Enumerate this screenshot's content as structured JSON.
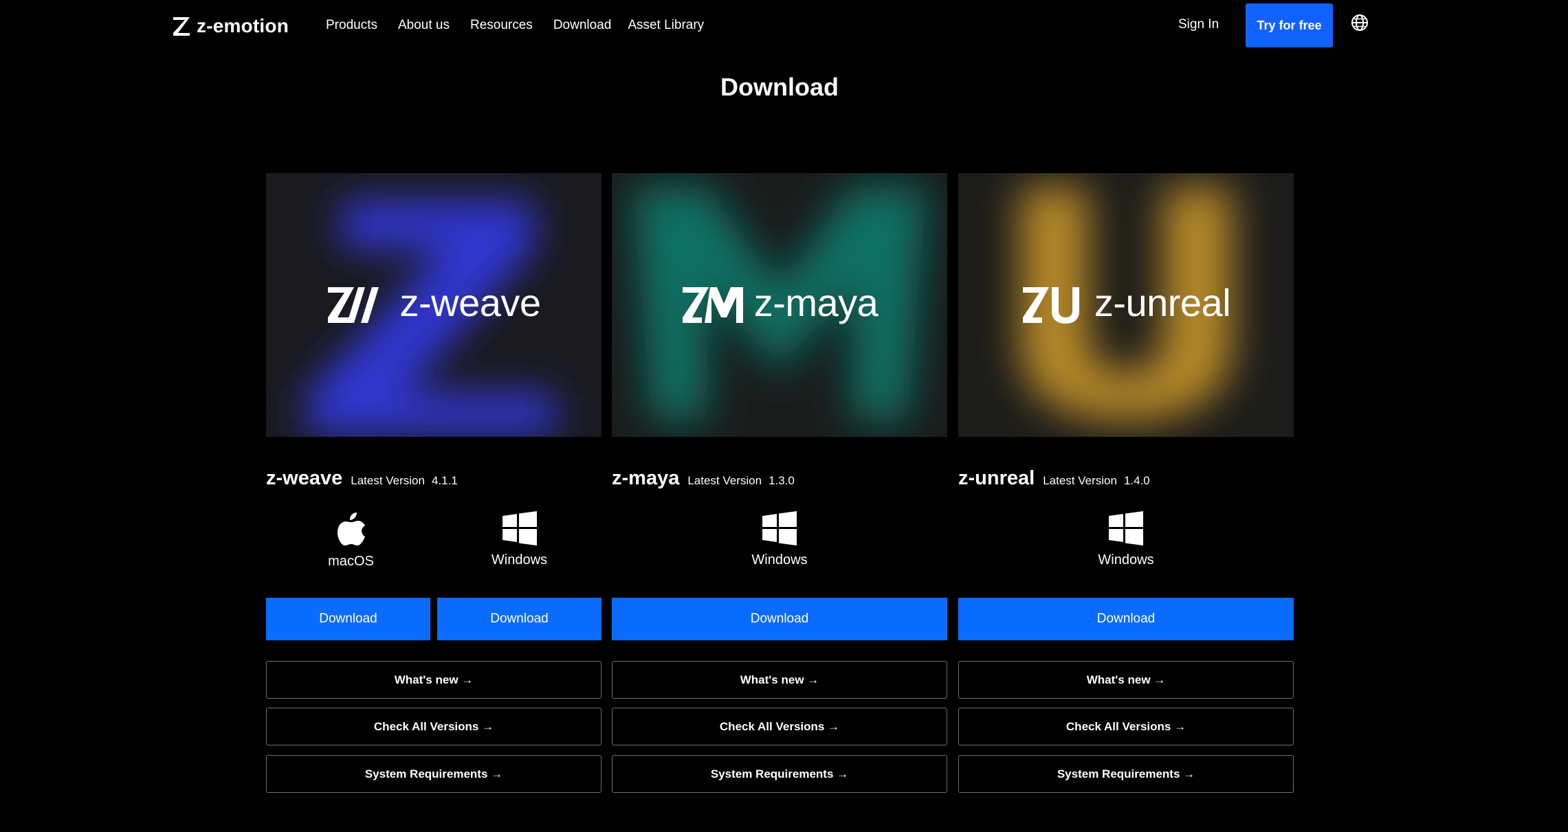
{
  "header": {
    "logo_text": "z-emotion",
    "nav": [
      "Products",
      "About us",
      "Resources",
      "Download",
      "Asset Library"
    ],
    "sign_in": "Sign In",
    "try_free": "Try for free",
    "globe_icon": "globe-icon"
  },
  "page": {
    "title": "Download"
  },
  "products": [
    {
      "hero_name": "z-weave",
      "name": "z-weave",
      "version_label": "Latest Version",
      "version": "4.1.1",
      "glow_color": "#3138d8",
      "platforms": [
        "macOS",
        "Windows"
      ],
      "download_labels": [
        "Download",
        "Download"
      ],
      "links": [
        "What's new →",
        "Check All Versions →",
        "System Requirements →"
      ]
    },
    {
      "hero_name": "z-maya",
      "name": "z-maya",
      "version_label": "Latest Version",
      "version": "1.3.0",
      "glow_color": "#0f7a6c",
      "platforms": [
        "Windows"
      ],
      "download_labels": [
        "Download"
      ],
      "links": [
        "What's new →",
        "Check All Versions →",
        "System Requirements →"
      ]
    },
    {
      "hero_name": "z-unreal",
      "name": "z-unreal",
      "version_label": "Latest Version",
      "version": "1.4.0",
      "glow_color": "#c9962a",
      "platforms": [
        "Windows"
      ],
      "download_labels": [
        "Download"
      ],
      "links": [
        "What's new →",
        "Check All Versions →",
        "System Requirements →"
      ]
    }
  ],
  "colors": {
    "accent": "#0a6bff",
    "try_button": "#1262ff",
    "background": "#000000"
  }
}
